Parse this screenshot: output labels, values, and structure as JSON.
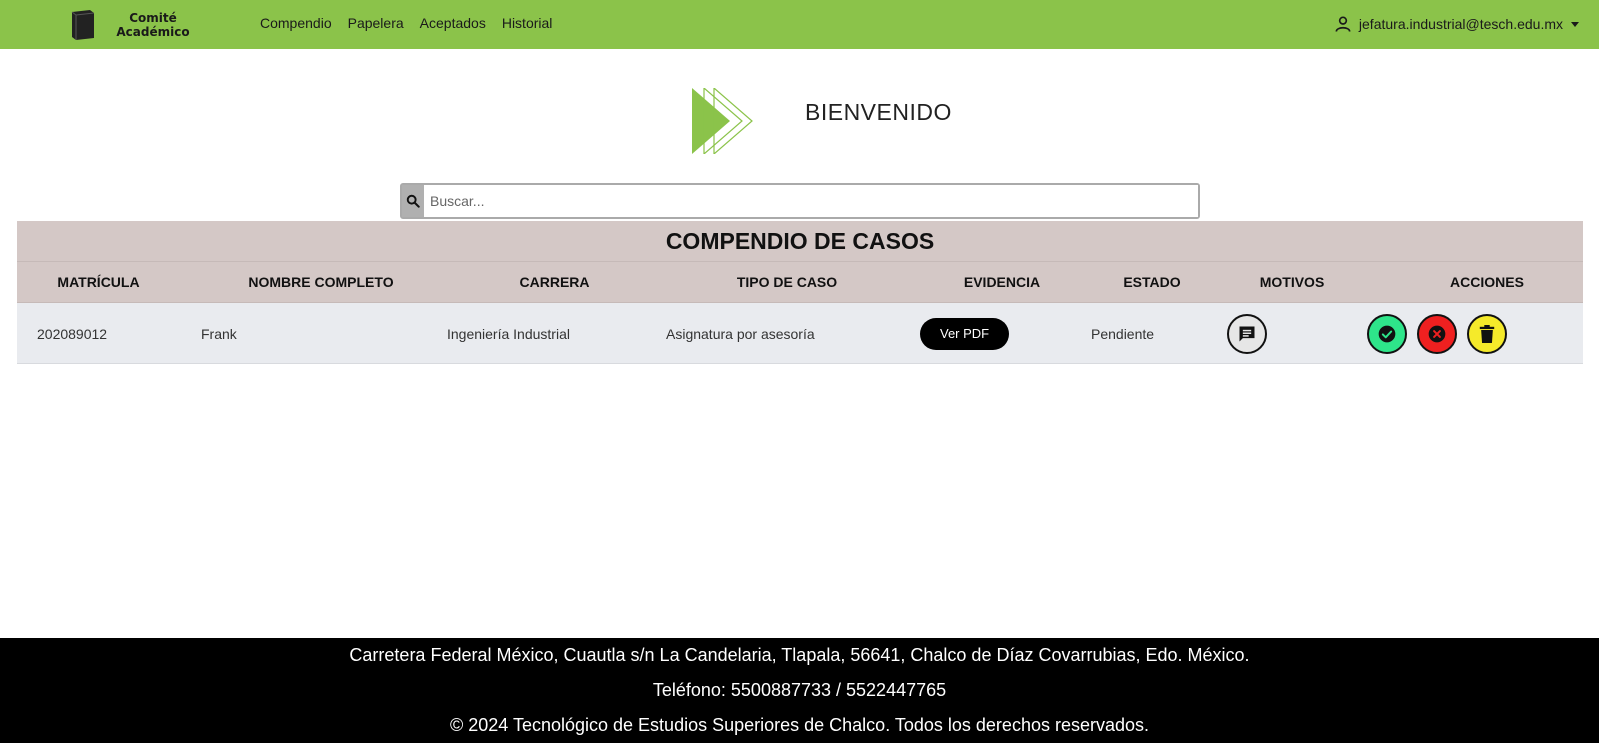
{
  "navbar": {
    "brand_line1": "Comité",
    "brand_line2": "Académico",
    "links": [
      "Compendio",
      "Papelera",
      "Aceptados",
      "Historial"
    ],
    "user_email": "jefatura.industrial@tesch.edu.mx",
    "bg_color": "#8bc34a"
  },
  "hero": {
    "welcome": "BIENVENIDO"
  },
  "search": {
    "placeholder": "Buscar..."
  },
  "table": {
    "title": "COMPENDIO DE CASOS",
    "headers": [
      "MATRÍCULA",
      "NOMBRE COMPLETO",
      "CARRERA",
      "TIPO DE CASO",
      "EVIDENCIA",
      "ESTADO",
      "MOTIVOS",
      "ACCIONES"
    ],
    "rows": [
      {
        "matricula": "202089012",
        "nombre": "Frank",
        "carrera": "Ingeniería Industrial",
        "tipo": "Asignatura por asesoría",
        "evidencia": "Ver PDF",
        "estado": "Pendiente",
        "motivos_icon": "comment-icon",
        "actions": [
          "check-icon",
          "close-icon",
          "trash-icon"
        ]
      }
    ]
  },
  "footer": {
    "address": "Carretera Federal México, Cuautla s/n La Candelaria, Tlapala, 56641, Chalco de Díaz Covarrubias, Edo. México.",
    "phone": "Teléfono: 5500887733 / 5522447765",
    "copyright": "© 2024 Tecnológico de Estudios Superiores de Chalco. Todos los derechos reservados."
  }
}
